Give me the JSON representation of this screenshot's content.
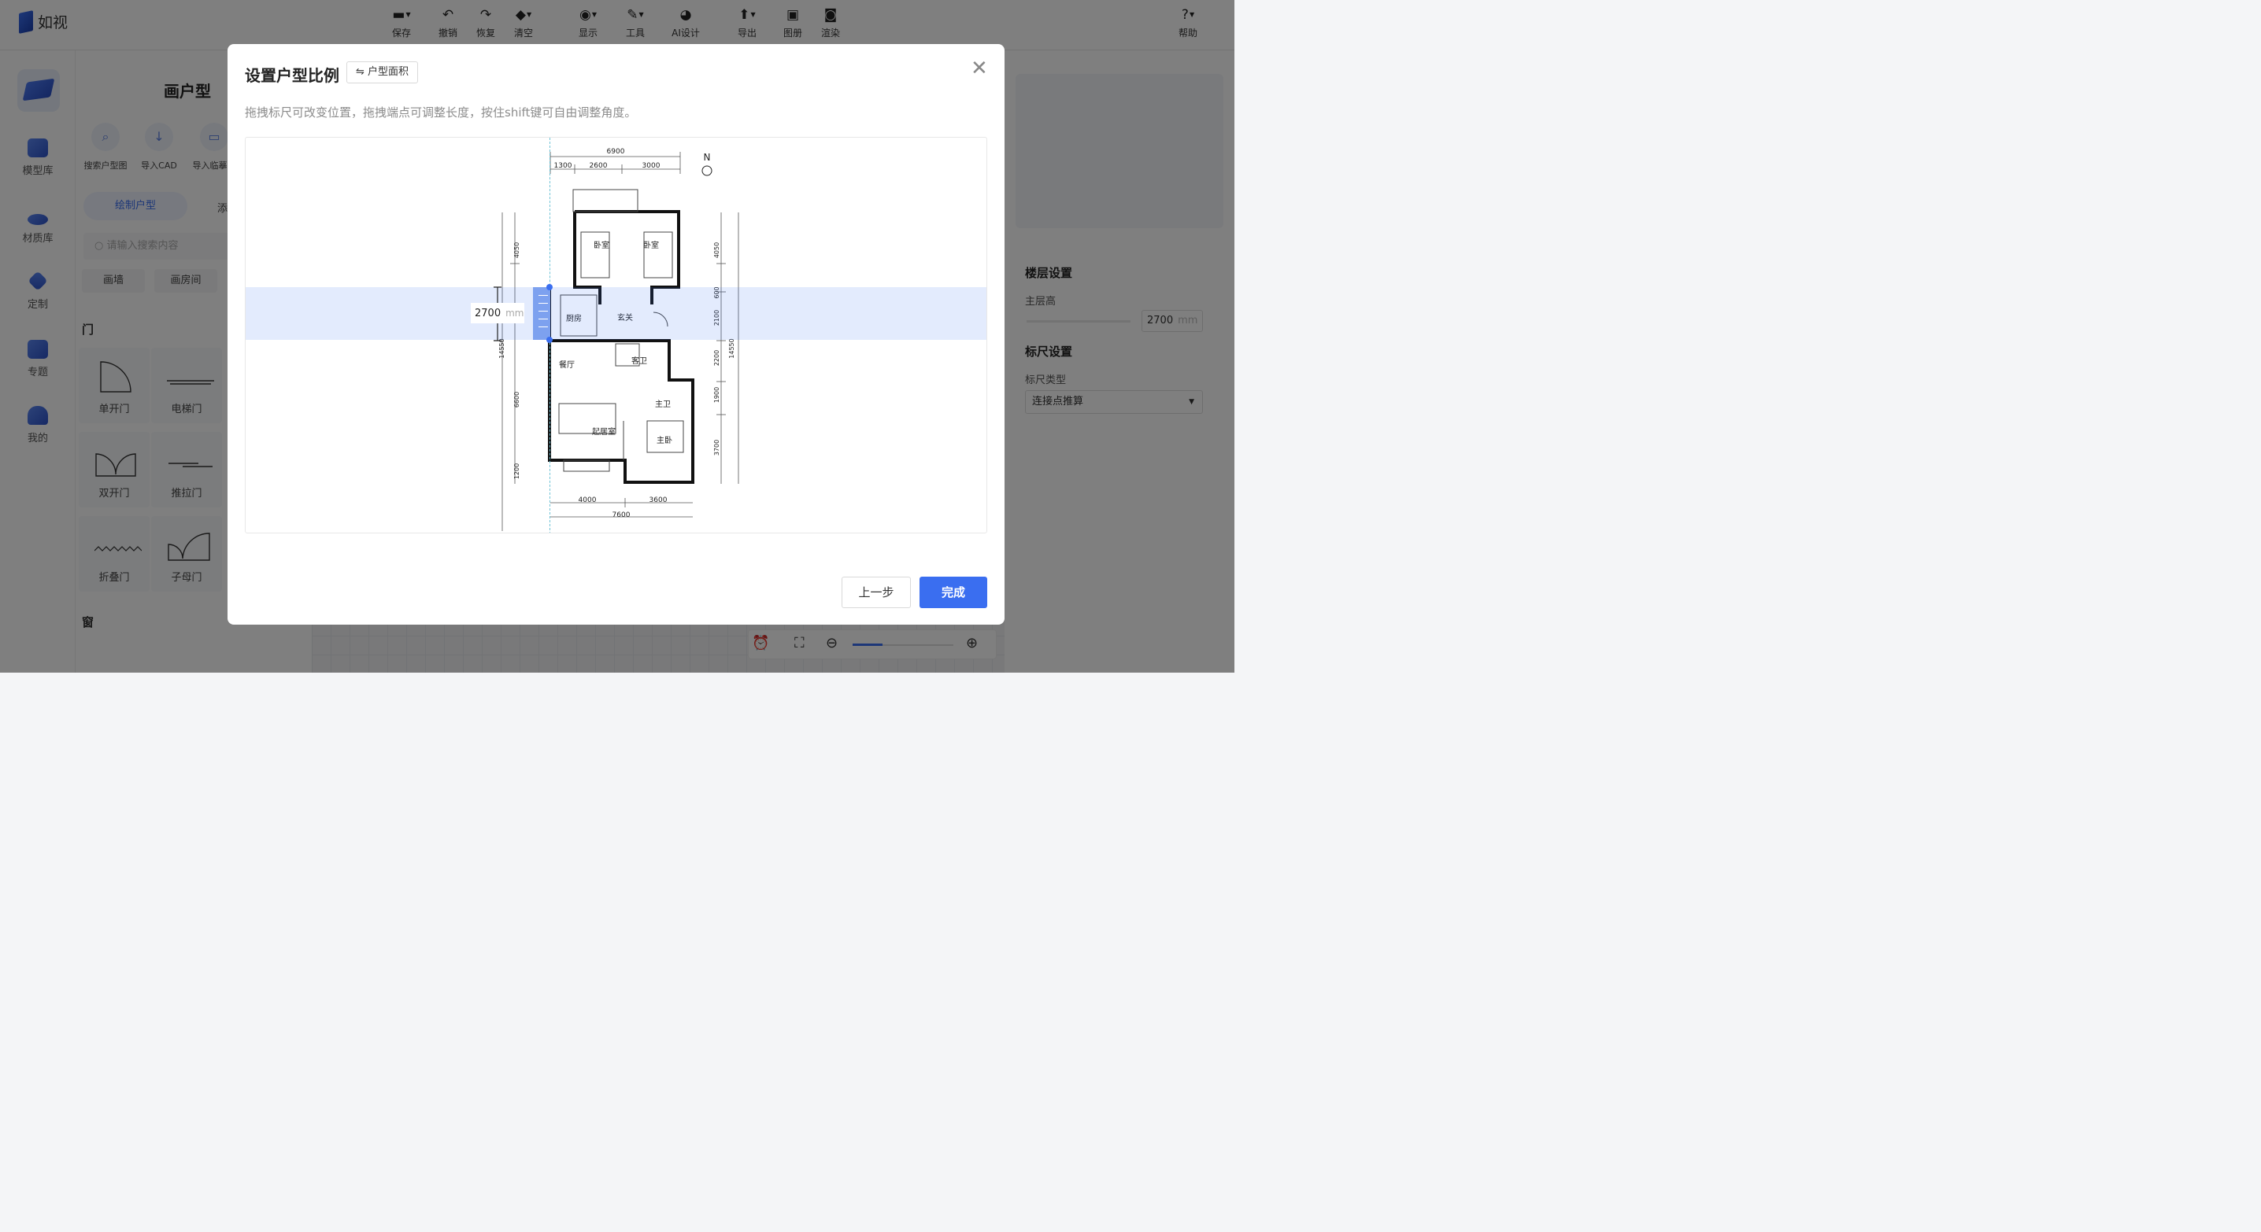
{
  "app": {
    "name": "如视"
  },
  "toolbar": [
    {
      "label": "保存",
      "icon": "save-icon",
      "glyph": "▬",
      "dropdown": true
    },
    {
      "label": "撤销",
      "icon": "undo-icon",
      "glyph": "↶",
      "dropdown": false
    },
    {
      "label": "恢复",
      "icon": "redo-icon",
      "glyph": "↷",
      "dropdown": false
    },
    {
      "label": "清空",
      "icon": "eraser-icon",
      "glyph": "◆",
      "dropdown": true
    },
    {
      "label": "显示",
      "icon": "eye-icon",
      "glyph": "◉",
      "dropdown": true
    },
    {
      "label": "工具",
      "icon": "wrench-icon",
      "glyph": "✎",
      "dropdown": true
    },
    {
      "label": "AI设计",
      "icon": "ai-design-icon",
      "glyph": "◕",
      "dropdown": false
    },
    {
      "label": "导出",
      "icon": "export-icon",
      "glyph": "⬆",
      "dropdown": true
    },
    {
      "label": "图册",
      "icon": "album-icon",
      "glyph": "▣",
      "dropdown": false
    },
    {
      "label": "渲染",
      "icon": "camera-icon",
      "glyph": "◙",
      "dropdown": false
    },
    {
      "label": "帮助",
      "icon": "help-icon",
      "glyph": "?",
      "dropdown": true
    }
  ],
  "leftnav": [
    {
      "label": "模型库"
    },
    {
      "label": "材质库"
    },
    {
      "label": "定制"
    },
    {
      "label": "专题"
    },
    {
      "label": "我的"
    }
  ],
  "panel": {
    "title": "画户型",
    "actions": [
      {
        "label": "搜索户型图"
      },
      {
        "label": "导入CAD"
      },
      {
        "label": "导入临摹图"
      }
    ],
    "tab_active": "绘制户型",
    "tab_other": "添",
    "search_placeholder": "请输入搜索内容",
    "chips": [
      "画墙",
      "画房间"
    ],
    "door_section": "门",
    "doors": [
      "单开门",
      "电梯门",
      "双开门",
      "推拉门",
      "折叠门",
      "子母门"
    ],
    "window_section": "窗"
  },
  "right_panel": {
    "floor_title": "楼层设置",
    "floor_height_label": "主层高",
    "floor_height_value": "2700",
    "floor_height_unit": "mm",
    "ruler_title": "标尺设置",
    "ruler_type_label": "标尺类型",
    "ruler_type_value": "连接点推算"
  },
  "modal": {
    "title": "设置户型比例",
    "switch_label": "⇋ 户型面积",
    "hint": "拖拽标尺可改变位置，拖拽端点可调整长度，按住shift键可自由调整角度。",
    "ruler_value": "2700",
    "ruler_unit": "mm",
    "prev_button": "上一步",
    "done_button": "完成",
    "accent": "#3a6ef0"
  },
  "floorplan": {
    "top_dims": [
      "6900",
      "1300",
      "2600",
      "3000"
    ],
    "bottom_dims": [
      "4000",
      "3600",
      "7600"
    ],
    "left_dims": [
      "4050",
      "14550",
      "6600",
      "1200"
    ],
    "right_dims": [
      "4050",
      "600",
      "2100",
      "2200",
      "1900",
      "3700",
      "14550"
    ],
    "north": "N",
    "rooms": [
      "卧室",
      "卧室",
      "厨房",
      "玄关",
      "餐厅",
      "客卫",
      "主卫",
      "起居室",
      "主卧"
    ]
  }
}
